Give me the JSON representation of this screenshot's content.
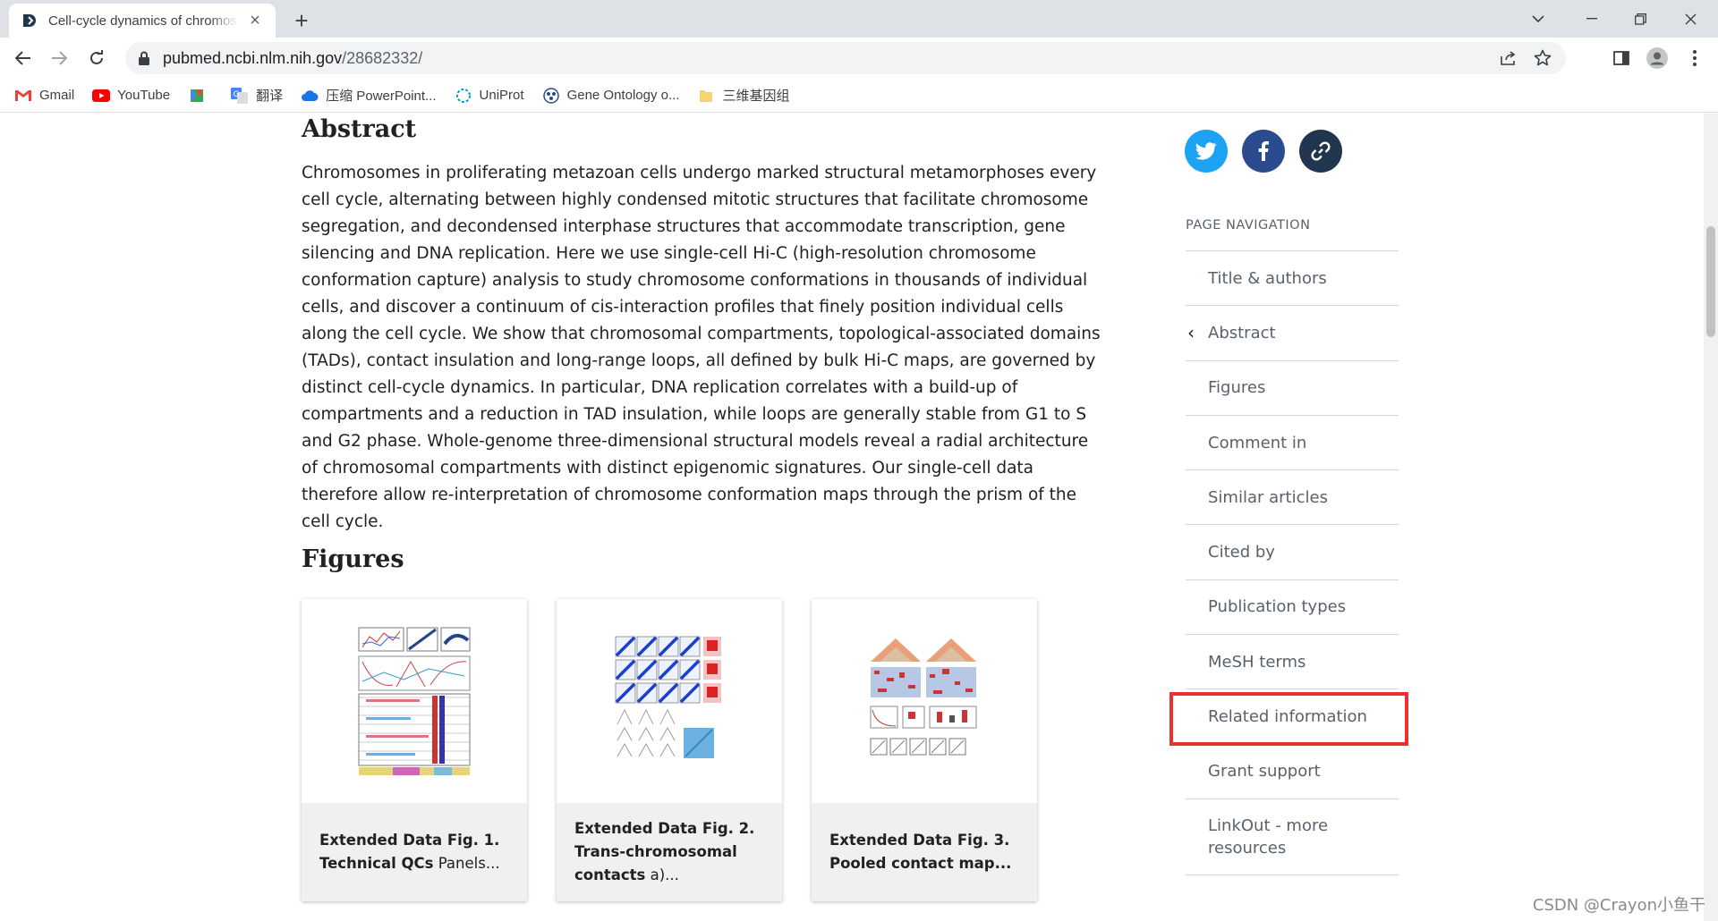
{
  "browser": {
    "tab_title": "Cell-cycle dynamics of chromosome organization at single-cell resolution - PubMed",
    "url_host": "pubmed.ncbi.nlm.nih.gov",
    "url_path": "/28682332/"
  },
  "bookmarks": [
    {
      "label": "Gmail",
      "icon": "gmail-icon"
    },
    {
      "label": "YouTube",
      "icon": "youtube-icon"
    },
    {
      "label": "",
      "icon": "google-maps-icon"
    },
    {
      "label": "翻译",
      "icon": "google-translate-icon"
    },
    {
      "label": "压缩 PowerPoint...",
      "icon": "cloud-icon"
    },
    {
      "label": "UniProt",
      "icon": "uniprot-icon"
    },
    {
      "label": "Gene Ontology o...",
      "icon": "gene-ontology-icon"
    },
    {
      "label": "三维基因组",
      "icon": "folder-icon"
    }
  ],
  "abstract": {
    "heading": "Abstract",
    "text": "Chromosomes in proliferating metazoan cells undergo marked structural metamorphoses every cell cycle, alternating between highly condensed mitotic structures that facilitate chromosome segregation, and decondensed interphase structures that accommodate transcription, gene silencing and DNA replication. Here we use single-cell Hi-C (high-resolution chromosome conformation capture) analysis to study chromosome conformations in thousands of individual cells, and discover a continuum of cis-interaction profiles that finely position individual cells along the cell cycle. We show that chromosomal compartments, topological-associated domains (TADs), contact insulation and long-range loops, all defined by bulk Hi-C maps, are governed by distinct cell-cycle dynamics. In particular, DNA replication correlates with a build-up of compartments and a reduction in TAD insulation, while loops are generally stable from G1 to S and G2 phase. Whole-genome three-dimensional structural models reveal a radial architecture of chromosomal compartments with distinct epigenomic signatures. Our single-cell data therefore allow re-interpretation of chromosome conformation maps through the prism of the cell cycle."
  },
  "figures": {
    "heading": "Figures",
    "items": [
      {
        "bold": "Extended Data Fig. 1. Technical QCs",
        "rest": " Panels..."
      },
      {
        "bold": "Extended Data Fig. 2. Trans-chromosomal contacts",
        "rest": " a)..."
      },
      {
        "bold": "Extended Data Fig. 3. Pooled contact map...",
        "rest": ""
      }
    ]
  },
  "share_icons": [
    "twitter-icon",
    "facebook-icon",
    "link-icon"
  ],
  "colors": {
    "twitter": "#1da1f2",
    "facebook": "#2a4b8d",
    "link": "#20364f",
    "highlight": "#e8322f"
  },
  "page_navigation": {
    "heading": "PAGE NAVIGATION",
    "items": [
      "Title & authors",
      "Abstract",
      "Figures",
      "Comment in",
      "Similar articles",
      "Cited by",
      "Publication types",
      "MeSH terms",
      "Related information",
      "Grant support",
      "LinkOut - more resources"
    ],
    "active": "Abstract",
    "highlighted": "Related information"
  },
  "watermark": "CSDN @Crayon小鱼干"
}
